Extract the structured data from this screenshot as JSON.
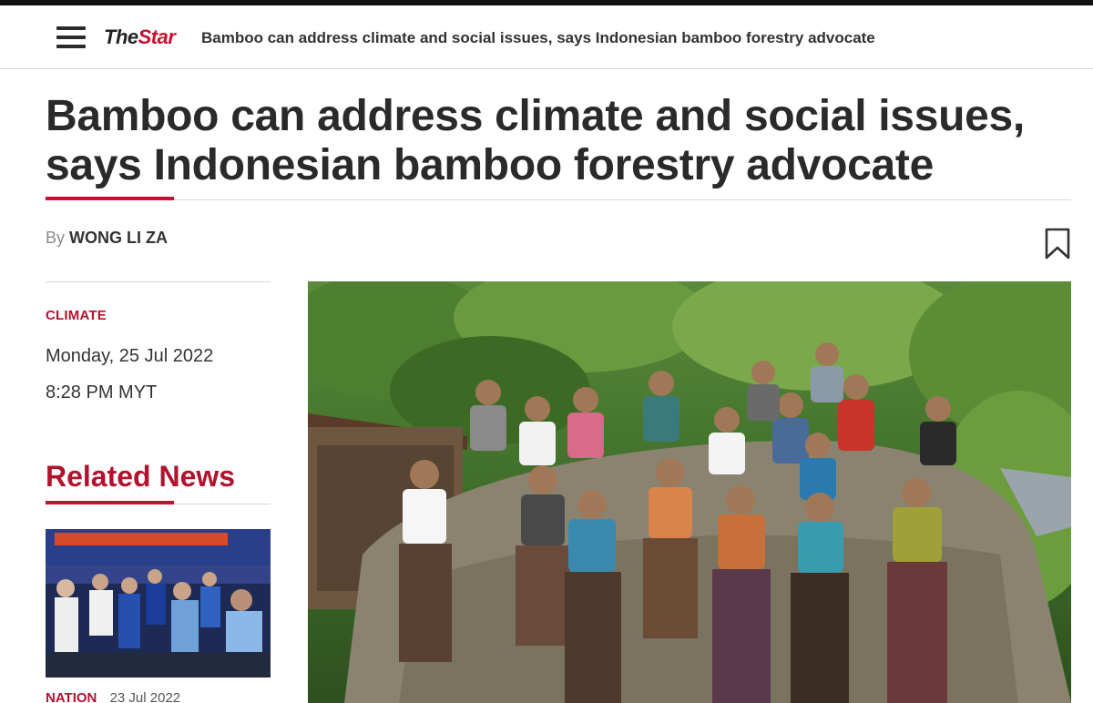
{
  "header": {
    "logo_the": "The",
    "logo_star": "Star",
    "title": "Bamboo can address climate and social issues, says Indonesian bamboo forestry advocate"
  },
  "article": {
    "headline_line1": "Bamboo can address climate and social issues,",
    "headline_line2": "says Indonesian bamboo forestry advocate",
    "byline_prefix": "By",
    "author": "WONG LI ZA",
    "category": "CLIMATE",
    "date": "Monday, 25 Jul 2022",
    "time": "8:28 PM MYT"
  },
  "related": {
    "title": "Related News",
    "items": [
      {
        "tag": "NATION",
        "date": "23 Jul 2022"
      }
    ]
  },
  "colors": {
    "brand_red": "#c8102e",
    "category_red": "#b3122d"
  },
  "icons": {
    "menu": "menu-icon",
    "bookmark": "bookmark-icon"
  }
}
